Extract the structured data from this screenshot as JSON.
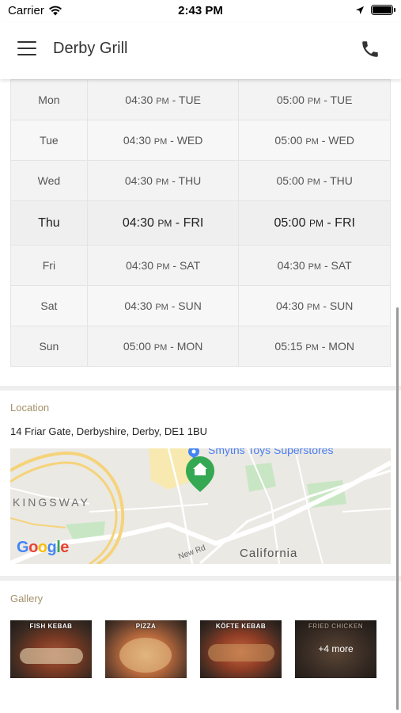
{
  "status_bar": {
    "carrier": "Carrier",
    "time": "2:43 PM"
  },
  "header": {
    "title": "Derby Grill",
    "menu_icon": "hamburger-menu-icon",
    "phone_icon": "phone-icon"
  },
  "hours": [
    {
      "day": "Mon",
      "open_time": "04:30",
      "open_ampm": "PM",
      "open_day": "- TUE",
      "close_time": "05:00",
      "close_ampm": "PM",
      "close_day": "- TUE"
    },
    {
      "day": "Tue",
      "open_time": "04:30",
      "open_ampm": "PM",
      "open_day": "- WED",
      "close_time": "05:00",
      "close_ampm": "PM",
      "close_day": "- WED"
    },
    {
      "day": "Wed",
      "open_time": "04:30",
      "open_ampm": "PM",
      "open_day": "- THU",
      "close_time": "05:00",
      "close_ampm": "PM",
      "close_day": "- THU"
    },
    {
      "day": "Thu",
      "open_time": "04:30",
      "open_ampm": "PM",
      "open_day": "- FRI",
      "close_time": "05:00",
      "close_ampm": "PM",
      "close_day": "- FRI"
    },
    {
      "day": "Fri",
      "open_time": "04:30",
      "open_ampm": "PM",
      "open_day": "- SAT",
      "close_time": "04:30",
      "close_ampm": "PM",
      "close_day": "- SAT"
    },
    {
      "day": "Sat",
      "open_time": "04:30",
      "open_ampm": "PM",
      "open_day": "- SUN",
      "close_time": "04:30",
      "close_ampm": "PM",
      "close_day": "- SUN"
    },
    {
      "day": "Sun",
      "open_time": "05:00",
      "open_ampm": "PM",
      "open_day": "- MON",
      "close_time": "05:15",
      "close_ampm": "PM",
      "close_day": "- MON"
    }
  ],
  "location": {
    "label": "Location",
    "address": "14 Friar Gate, Derbyshire, Derby, DE1 1BU",
    "map": {
      "poi": "Smyths Toys Superstores",
      "area1": "KINGSWAY",
      "area2": "California",
      "road": "New Rd",
      "attribution": "Google"
    }
  },
  "gallery": {
    "label": "Gallery",
    "items": [
      {
        "label": "FISH KEBAB"
      },
      {
        "label": "PIZZA"
      },
      {
        "label": "KÖFTE KEBAB"
      },
      {
        "label": "FRIED CHICKEN",
        "overlay": "+4 more"
      }
    ]
  },
  "colors": {
    "accent": "#a3906a",
    "map_pin": "#34a853",
    "poi_pin": "#4285f4"
  }
}
